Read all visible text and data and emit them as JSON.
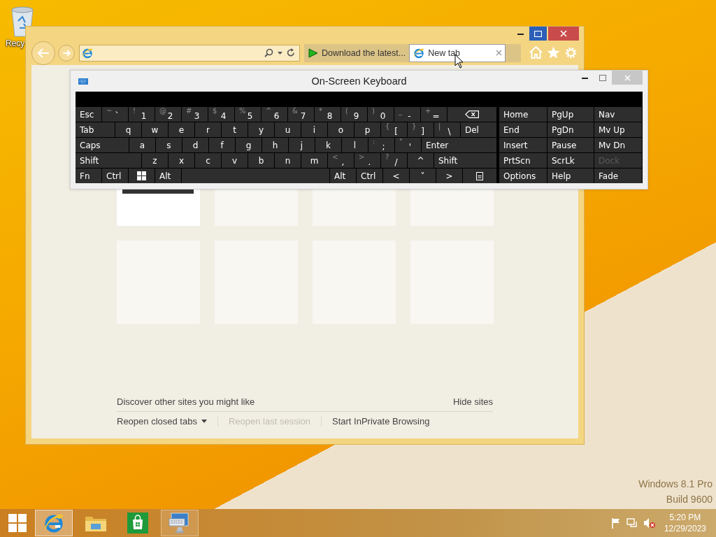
{
  "desktop": {
    "icons": [
      {
        "label": "Recy"
      }
    ],
    "watermark": [
      "Windows 8.1 Pro",
      "Build 9600"
    ]
  },
  "browser": {
    "tabs": [
      {
        "label": "Download the latest...",
        "selected": false
      },
      {
        "label": "New tab",
        "selected": true
      }
    ],
    "tiles": [
      {
        "kind": "thumbnail"
      },
      {
        "kind": "empty"
      },
      {
        "kind": "empty"
      },
      {
        "kind": "empty"
      },
      {
        "kind": "empty"
      },
      {
        "kind": "empty"
      },
      {
        "kind": "empty"
      },
      {
        "kind": "empty"
      }
    ],
    "discover": "Discover other sites you might like",
    "hide_sites": "Hide sites",
    "links": [
      {
        "label": "Reopen closed tabs",
        "disabled": false,
        "dropdown": true
      },
      {
        "label": "Reopen last session",
        "disabled": true,
        "dropdown": false
      },
      {
        "label": "Start InPrivate Browsing",
        "disabled": false,
        "dropdown": false
      }
    ]
  },
  "keyboard": {
    "title": "On-Screen Keyboard",
    "keys": [
      {
        "kind": "text",
        "label": "Esc"
      },
      {
        "kind": "dual",
        "shift": "~",
        "label": "`"
      },
      {
        "kind": "dual",
        "shift": "!",
        "label": "1"
      },
      {
        "kind": "dual",
        "shift": "@",
        "label": "2"
      },
      {
        "kind": "dual",
        "shift": "#",
        "label": "3"
      },
      {
        "kind": "dual",
        "shift": "$",
        "label": "4"
      },
      {
        "kind": "dual",
        "shift": "%",
        "label": "5"
      },
      {
        "kind": "dual",
        "shift": "^",
        "label": "6"
      },
      {
        "kind": "dual",
        "shift": "&",
        "label": "7"
      },
      {
        "kind": "dual",
        "shift": "*",
        "label": "8"
      },
      {
        "kind": "dual",
        "shift": "(",
        "label": "9"
      },
      {
        "kind": "dual",
        "shift": ")",
        "label": "0"
      },
      {
        "kind": "dual",
        "shift": "_",
        "label": "-"
      },
      {
        "kind": "dual",
        "shift": "+",
        "label": "="
      },
      {
        "kind": "backspace"
      },
      {
        "kind": "text",
        "label": "Tab"
      },
      {
        "kind": "char",
        "label": "q"
      },
      {
        "kind": "char",
        "label": "w"
      },
      {
        "kind": "char",
        "label": "e"
      },
      {
        "kind": "char",
        "label": "r"
      },
      {
        "kind": "char",
        "label": "t"
      },
      {
        "kind": "char",
        "label": "y"
      },
      {
        "kind": "char",
        "label": "u"
      },
      {
        "kind": "char",
        "label": "i"
      },
      {
        "kind": "char",
        "label": "o"
      },
      {
        "kind": "char",
        "label": "p"
      },
      {
        "kind": "dual",
        "shift": "{",
        "label": "["
      },
      {
        "kind": "dual",
        "shift": "}",
        "label": "]"
      },
      {
        "kind": "dual",
        "shift": "|",
        "label": "\\"
      },
      {
        "kind": "text",
        "label": "Del"
      },
      {
        "kind": "text",
        "label": "Caps"
      },
      {
        "kind": "char",
        "label": "a"
      },
      {
        "kind": "char",
        "label": "s"
      },
      {
        "kind": "char",
        "label": "d"
      },
      {
        "kind": "char",
        "label": "f"
      },
      {
        "kind": "char",
        "label": "g"
      },
      {
        "kind": "char",
        "label": "h"
      },
      {
        "kind": "char",
        "label": "j"
      },
      {
        "kind": "char",
        "label": "k"
      },
      {
        "kind": "char",
        "label": "l"
      },
      {
        "kind": "dual",
        "shift": ":",
        "label": ";"
      },
      {
        "kind": "dual",
        "shift": "\"",
        "label": "'"
      },
      {
        "kind": "text",
        "label": "Enter"
      },
      {
        "kind": "text",
        "label": "Shift"
      },
      {
        "kind": "char",
        "label": "z"
      },
      {
        "kind": "char",
        "label": "x"
      },
      {
        "kind": "char",
        "label": "c"
      },
      {
        "kind": "char",
        "label": "v"
      },
      {
        "kind": "char",
        "label": "b"
      },
      {
        "kind": "char",
        "label": "n"
      },
      {
        "kind": "char",
        "label": "m"
      },
      {
        "kind": "dual",
        "shift": "<",
        "label": ","
      },
      {
        "kind": "dual",
        "shift": ">",
        "label": "."
      },
      {
        "kind": "dual",
        "shift": "?",
        "label": "/"
      },
      {
        "kind": "char",
        "label": "^"
      },
      {
        "kind": "text",
        "label": "Shift"
      },
      {
        "kind": "text",
        "label": "Fn"
      },
      {
        "kind": "text",
        "label": "Ctrl"
      },
      {
        "kind": "windows"
      },
      {
        "kind": "text",
        "label": "Alt"
      },
      {
        "kind": "space"
      },
      {
        "kind": "text",
        "label": "Alt"
      },
      {
        "kind": "text",
        "label": "Ctrl"
      },
      {
        "kind": "char",
        "label": "<"
      },
      {
        "kind": "char",
        "label": "˅"
      },
      {
        "kind": "char",
        "label": ">"
      },
      {
        "kind": "menu"
      }
    ],
    "nav": [
      {
        "label": "Home",
        "disabled": false
      },
      {
        "label": "PgUp",
        "disabled": false
      },
      {
        "label": "Nav",
        "disabled": false
      },
      {
        "label": "End",
        "disabled": false
      },
      {
        "label": "PgDn",
        "disabled": false
      },
      {
        "label": "Mv Up",
        "disabled": false
      },
      {
        "label": "Insert",
        "disabled": false
      },
      {
        "label": "Pause",
        "disabled": false
      },
      {
        "label": "Mv Dn",
        "disabled": false
      },
      {
        "label": "PrtScn",
        "disabled": false
      },
      {
        "label": "ScrLk",
        "disabled": false
      },
      {
        "label": "Dock",
        "disabled": true
      },
      {
        "label": "Options",
        "disabled": false
      },
      {
        "label": "Help",
        "disabled": false
      },
      {
        "label": "Fade",
        "disabled": false
      }
    ]
  },
  "taskbar": {
    "items": [
      {
        "kind": "ie",
        "selected": true,
        "running": true
      },
      {
        "kind": "explorer",
        "selected": false,
        "running": false
      },
      {
        "kind": "store",
        "selected": false,
        "running": false
      },
      {
        "kind": "keyboard",
        "selected": false,
        "running": true
      }
    ],
    "time": "5:20 PM",
    "date": "12/29/2023"
  }
}
